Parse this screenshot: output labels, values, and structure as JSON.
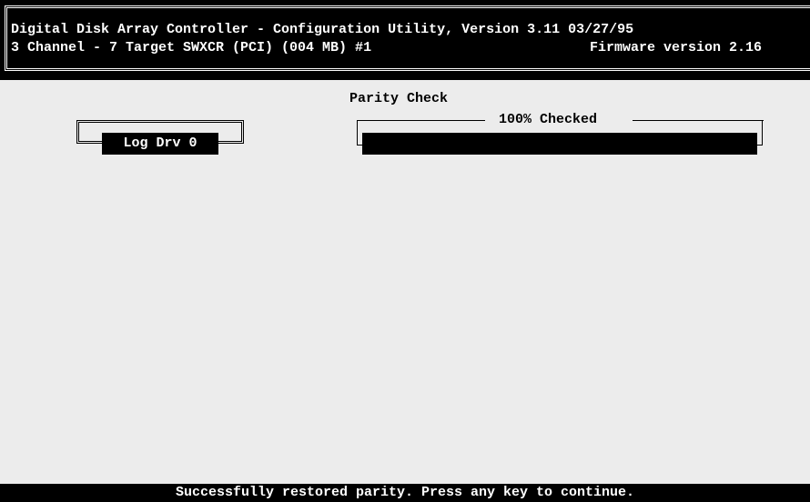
{
  "header": {
    "title_line": "Digital Disk Array Controller - Configuration Utility, Version 3.11 03/27/95",
    "controller_info": "3 Channel - 7 Target SWXCR (PCI) (004 MB) #1",
    "firmware": "Firmware version 2.16"
  },
  "logical_drive": {
    "label": "Log Drv 0"
  },
  "parity_check": {
    "title": "Parity Check",
    "status": "100% Checked",
    "progress_percent": 100
  },
  "status_bar": {
    "message": "Successfully restored parity. Press any key to continue."
  },
  "colors": {
    "background": "#ececec",
    "foreground": "#000000",
    "inverse_text": "#ffffff"
  }
}
